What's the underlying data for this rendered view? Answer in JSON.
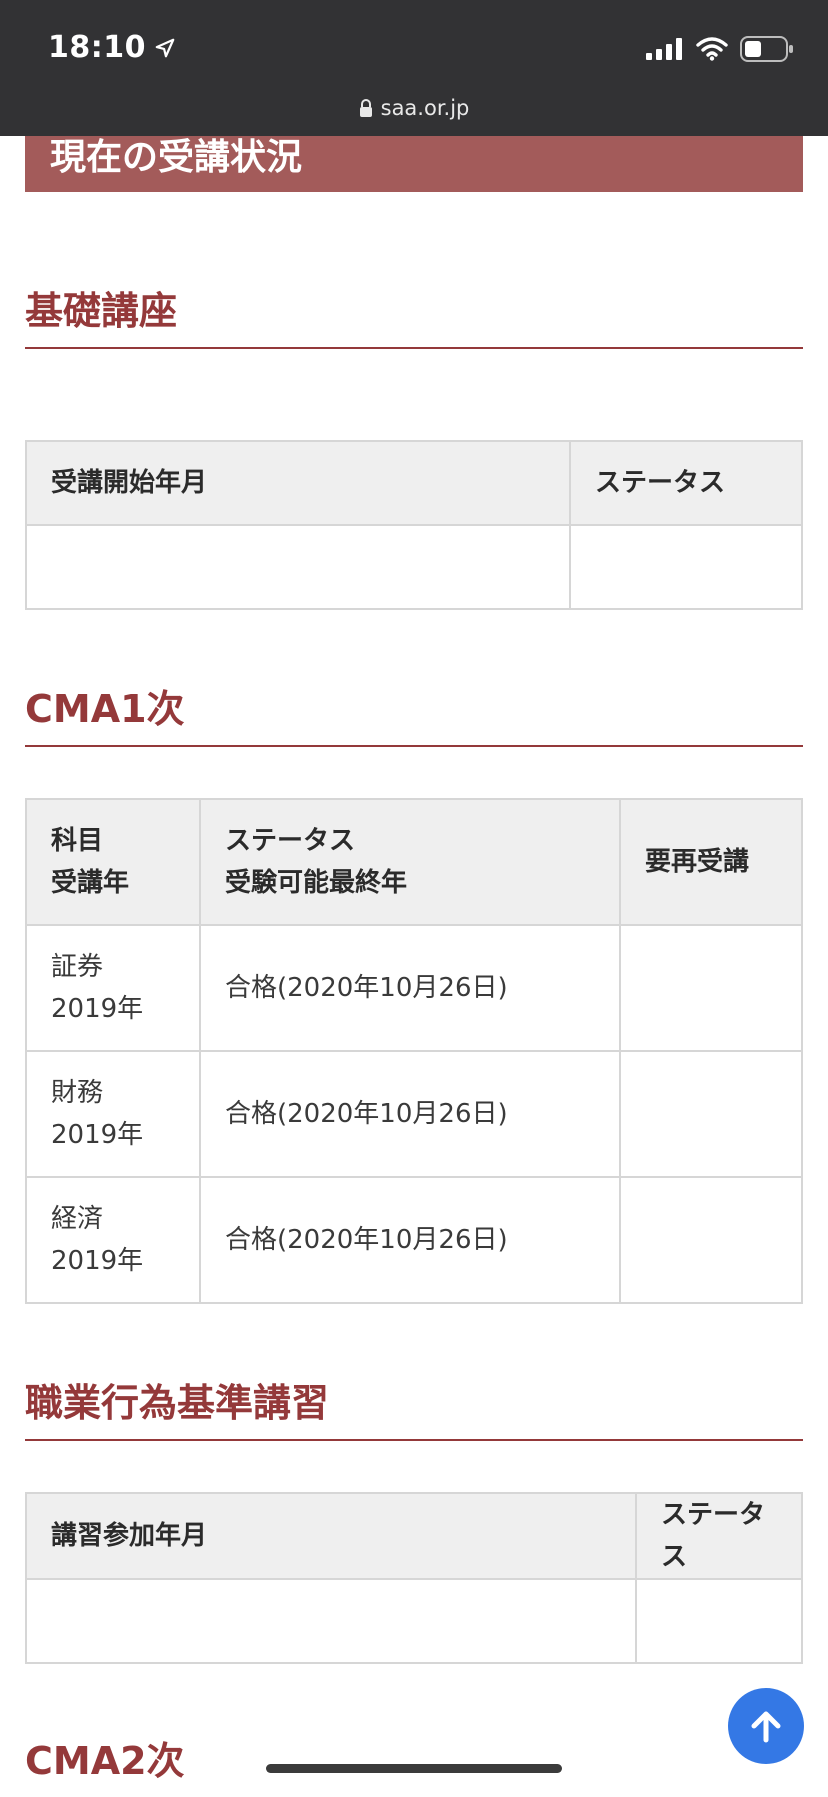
{
  "status_bar": {
    "time": "18:10",
    "url": "saa.or.jp"
  },
  "banner_title": "現在の受講状況",
  "kiso": {
    "heading": "基礎講座",
    "headers": [
      "受講開始年月",
      "ステータス"
    ]
  },
  "cma1": {
    "heading": "CMA1次",
    "headers": [
      [
        "科目",
        "受講年"
      ],
      [
        "ステータス",
        "受験可能最終年"
      ],
      [
        "要再受講"
      ]
    ],
    "rows": [
      {
        "subject": "証券",
        "year": "2019年",
        "status": "合格(2020年10月26日)",
        "retake": ""
      },
      {
        "subject": "財務",
        "year": "2019年",
        "status": "合格(2020年10月26日)",
        "retake": ""
      },
      {
        "subject": "経済",
        "year": "2019年",
        "status": "合格(2020年10月26日)",
        "retake": ""
      }
    ]
  },
  "ethics": {
    "heading": "職業行為基準講習",
    "headers": [
      "講習参加年月",
      "ステータス"
    ]
  },
  "cma2": {
    "heading": "CMA2次"
  },
  "colors": {
    "accent": "#94393a",
    "banner": "#a35b5a",
    "status_bar": "#323234",
    "scroll_button": "#3478e5"
  },
  "icons": [
    "location-arrow-icon",
    "signal-icon",
    "wifi-icon",
    "battery-icon",
    "lock-icon",
    "arrow-up-icon"
  ]
}
